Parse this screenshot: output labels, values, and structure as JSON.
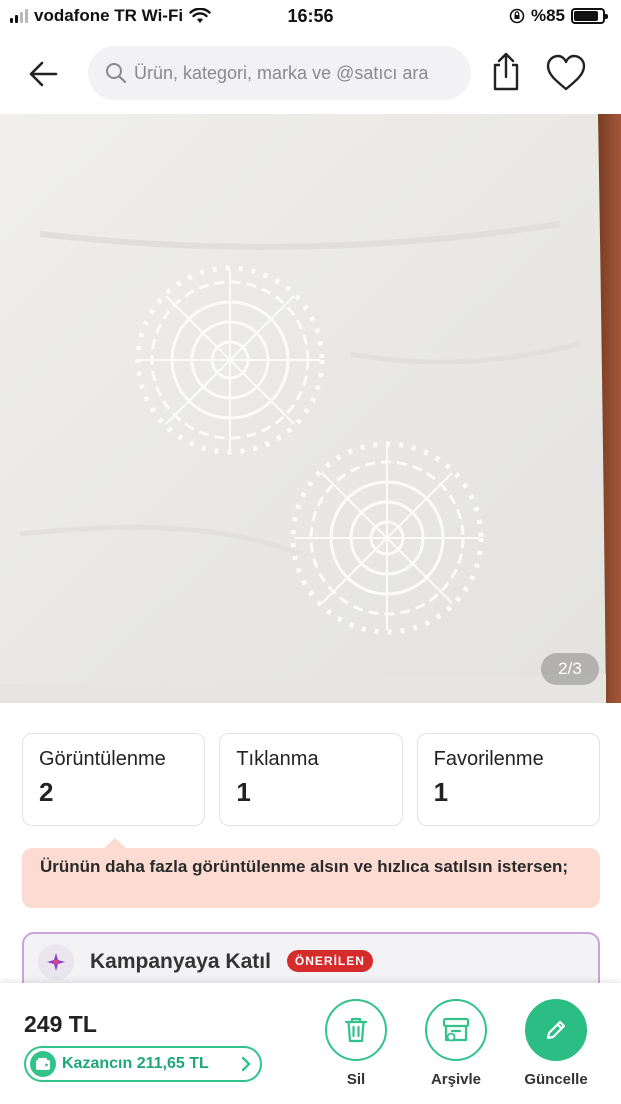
{
  "status_bar": {
    "carrier": "vodafone TR Wi-Fi",
    "time": "16:56",
    "battery": "%85",
    "battery_level": 0.85
  },
  "nav": {
    "search_placeholder": "Ürün, kategori, marka ve @satıcı ara",
    "icons": [
      "back-arrow-icon",
      "search-icon",
      "share-icon",
      "heart-icon"
    ]
  },
  "gallery": {
    "counter": "2/3"
  },
  "stats": [
    {
      "label": "Görüntülenme",
      "value": "2"
    },
    {
      "label": "Tıklanma",
      "value": "1"
    },
    {
      "label": "Favorilenme",
      "value": "1"
    }
  ],
  "tip": {
    "text": "Ürünün daha fazla görüntülenme alsın ve hızlıca satılsın istersen;"
  },
  "campaign": {
    "title": "Kampanyaya Katıl",
    "badge": "ÖNERİLEN"
  },
  "bottom_bar": {
    "price": "249 TL",
    "earnings": "Kazancın 211,65 TL",
    "actions": [
      {
        "label": "Sil",
        "icon": "trash-icon"
      },
      {
        "label": "Arşivle",
        "icon": "archive-icon"
      },
      {
        "label": "Güncelle",
        "icon": "pencil-icon"
      }
    ]
  },
  "colors": {
    "accent_green": "#2bbd83",
    "tip_background": "#fcdcd2",
    "badge_red": "#d62b2b",
    "campaign_border": "#c9a3d9"
  }
}
